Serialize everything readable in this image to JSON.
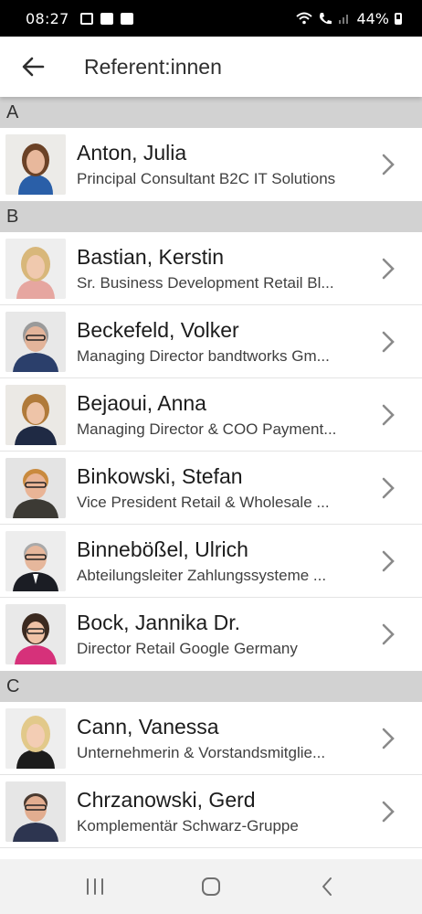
{
  "status": {
    "time": "08:27",
    "battery": "44%",
    "left_icons": [
      "dual-sim-icon",
      "gallery-icon",
      "checkbox-icon"
    ],
    "right_icons": [
      "wifi-icon",
      "call-icon",
      "signal-icon",
      "battery-icon"
    ]
  },
  "header": {
    "title": "Referent:innen",
    "back_icon": "arrow-left-icon"
  },
  "sections": [
    {
      "letter": "A",
      "people": [
        {
          "name": "Anton, Julia",
          "subtitle": "Principal Consultant B2C IT Solutions"
        }
      ]
    },
    {
      "letter": "B",
      "people": [
        {
          "name": "Bastian, Kerstin",
          "subtitle": "Sr. Business Development Retail Bl..."
        },
        {
          "name": "Beckefeld, Volker",
          "subtitle": "Managing Director bandtworks Gm..."
        },
        {
          "name": "Bejaoui, Anna",
          "subtitle": "Managing Director & COO Payment..."
        },
        {
          "name": "Binkowski, Stefan",
          "subtitle": "Vice President Retail & Wholesale ..."
        },
        {
          "name": "Binnebößel, Ulrich",
          "subtitle": "Abteilungsleiter Zahlungssysteme ..."
        },
        {
          "name": "Bock, Jannika Dr.",
          "subtitle": "Director Retail Google Germany"
        }
      ]
    },
    {
      "letter": "C",
      "people": [
        {
          "name": "Cann, Vanessa",
          "subtitle": "Unternehmerin & Vorstandsmitglie..."
        },
        {
          "name": "Chrzanowski, Gerd",
          "subtitle": "Komplementär Schwarz-Gruppe"
        }
      ]
    }
  ],
  "nav": {
    "recent_icon": "recent-apps-icon",
    "home_icon": "home-icon",
    "back_icon": "nav-back-icon"
  },
  "colors": {
    "section_header_bg": "#d2d2d2",
    "chevron": "#8a8a8a",
    "status_bar_bg": "#000000"
  }
}
